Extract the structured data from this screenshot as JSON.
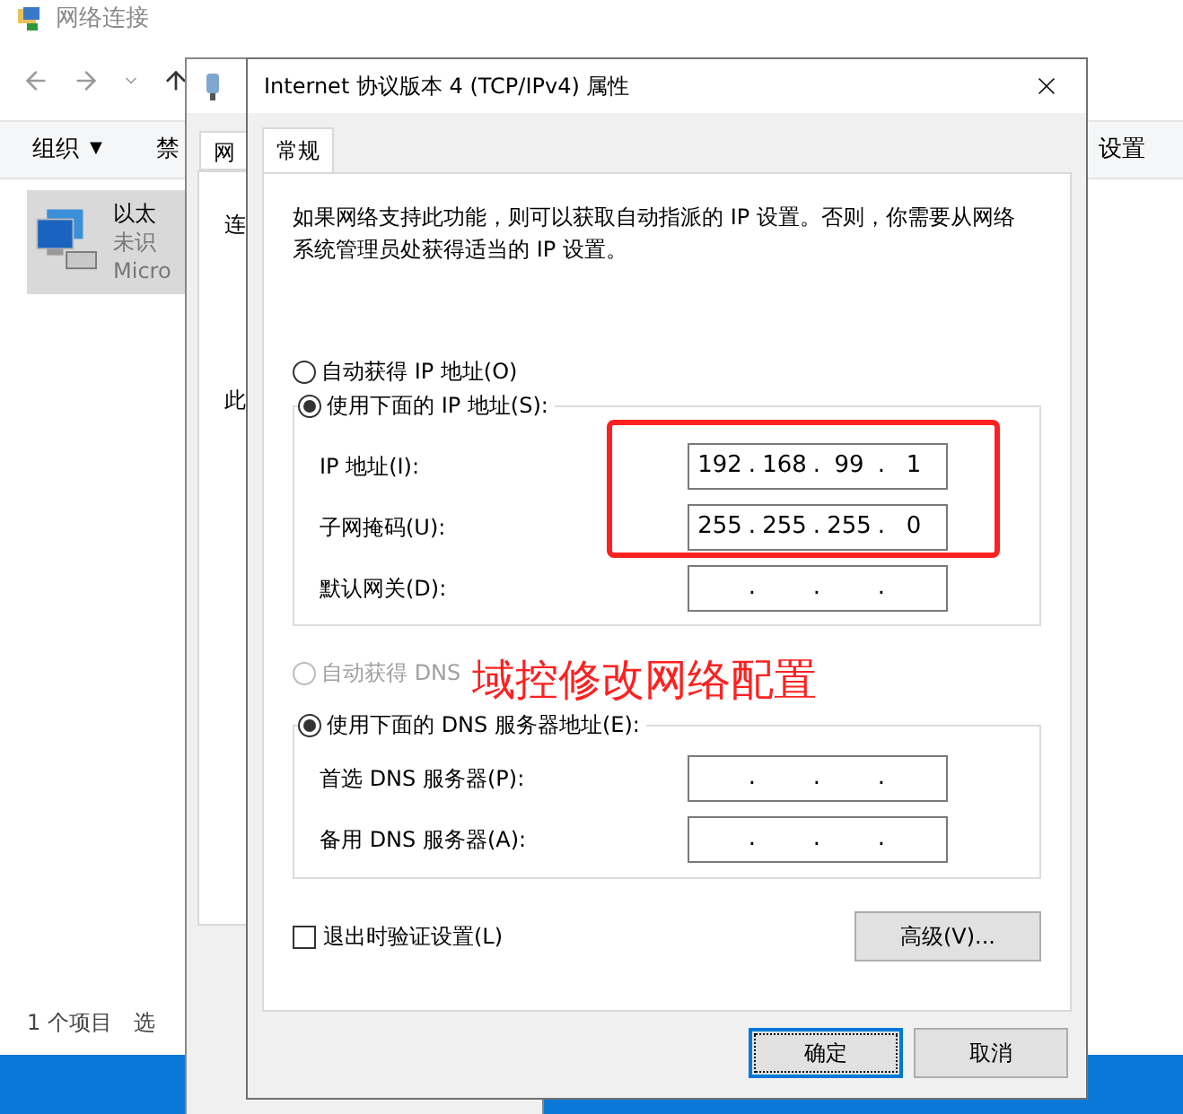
{
  "explorer": {
    "title": "网络连接",
    "toolbar": [
      {
        "label": "组织",
        "menu": true
      },
      {
        "label": "禁",
        "menu": false
      },
      {
        "label": "设置",
        "menu": false
      }
    ],
    "menu_caret": "▼",
    "item": {
      "lines": [
        "以太",
        "未识",
        "Micro"
      ],
      "selected": true
    },
    "status": [
      "1 个项目",
      "选"
    ]
  },
  "back_dialog": {
    "tab": "网",
    "texts": [
      "连",
      "此"
    ]
  },
  "dialog": {
    "title": "Internet 协议版本 4 (TCP/IPv4) 属性",
    "tabs": [
      {
        "label": "常规",
        "selected": true
      }
    ],
    "description": "如果网络支持此功能，则可以获取自动指派的 IP 设置。否则，你需要从网络系统管理员处获得适当的 IP 设置。",
    "ip_modes": [
      {
        "label": "自动获得 IP 地址(O)",
        "selected": false,
        "disabled": false
      },
      {
        "label": "使用下面的 IP 地址(S):",
        "selected": true,
        "disabled": false
      }
    ],
    "ip_fields": [
      {
        "label": "IP 地址(I):",
        "octets": [
          "192",
          "168",
          "99",
          "1"
        ]
      },
      {
        "label": "子网掩码(U):",
        "octets": [
          "255",
          "255",
          "255",
          "0"
        ]
      },
      {
        "label": "默认网关(D):"
      }
    ],
    "dns_modes": [
      {
        "label": "自动获得 DNS",
        "selected": false,
        "disabled": true
      },
      {
        "label": "使用下面的 DNS 服务器地址(E):",
        "selected": true,
        "disabled": false
      }
    ],
    "dns_fields": [
      {
        "label": "首选 DNS 服务器(P):"
      },
      {
        "label": "备用 DNS 服务器(A):"
      }
    ],
    "octet_separator": ".",
    "validate": {
      "label": "退出时验证设置(L)",
      "checked": false
    },
    "advanced": "高级(V)...",
    "buttons": [
      {
        "label": "确定",
        "default": true
      },
      {
        "label": "取消",
        "default": false
      }
    ]
  },
  "annotation": {
    "text": "域控修改网络配置",
    "highlight_box": true
  }
}
